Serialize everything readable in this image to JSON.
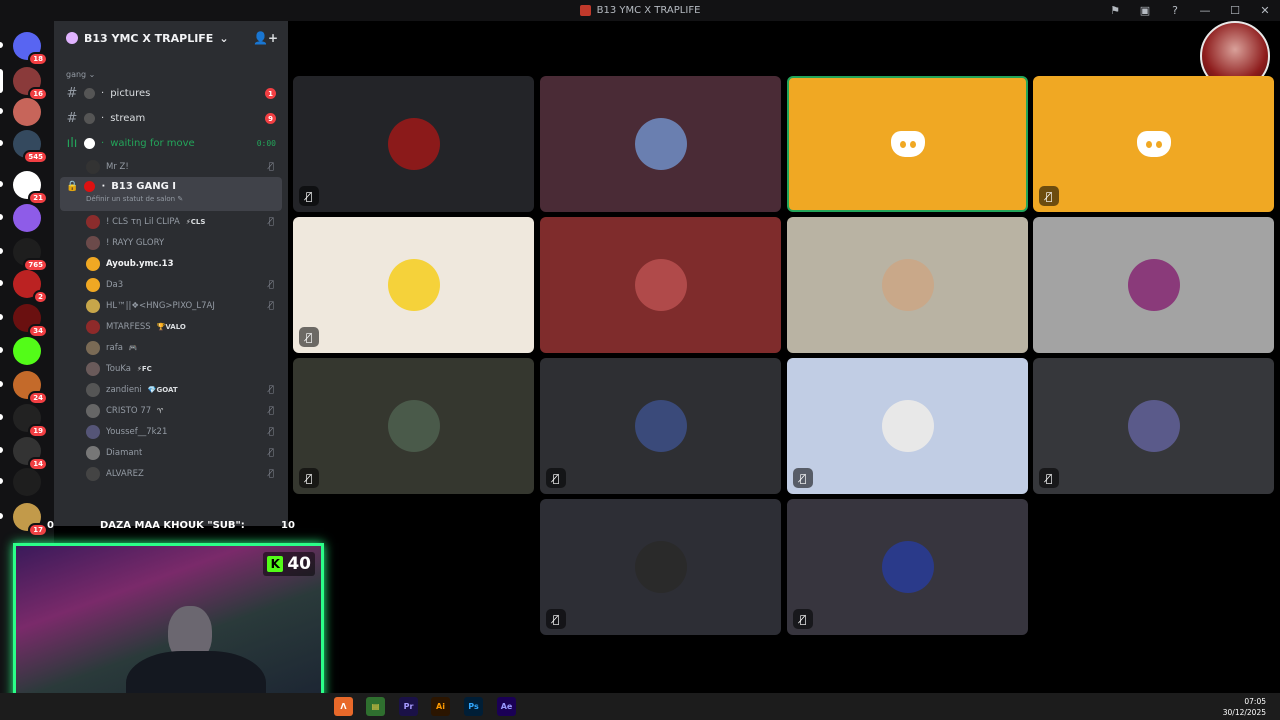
{
  "window": {
    "title": "B13 YMC X TRAPLIFE"
  },
  "servers": [
    {
      "badge": "18",
      "color": "#5865f2",
      "name": "discord-home"
    },
    {
      "badge": "16",
      "color": "#8a3a3a"
    },
    {
      "badge": "",
      "color": "#c7655a"
    },
    {
      "badge": "545",
      "color": "#34495e"
    },
    {
      "badge": "21",
      "color": "#ffffff"
    },
    {
      "badge": "",
      "color": "#8e5ce8"
    },
    {
      "badge": "765",
      "color": "#1e1e1e"
    },
    {
      "badge": "2",
      "color": "#b22"
    },
    {
      "badge": "34",
      "color": "#6a1010"
    },
    {
      "badge": "",
      "color": "#53fc18"
    },
    {
      "badge": "24",
      "color": "#c46a2a"
    },
    {
      "badge": "19",
      "color": "#222"
    },
    {
      "badge": "14",
      "color": "#333"
    },
    {
      "badge": "",
      "color": "#1e1e1e"
    },
    {
      "badge": "17",
      "color": "#c29a4a"
    }
  ],
  "sidebar": {
    "guild_name": "B13 YMC X TRAPLIFE",
    "category": "gang",
    "channels": [
      {
        "name": "pictures",
        "badge": "1"
      },
      {
        "name": "stream",
        "badge": "9"
      }
    ],
    "voice_waiting": {
      "name": "waiting for move",
      "timer": "0:00",
      "user": "Mr Z!"
    },
    "active_voice": {
      "name": "B13 GANG I",
      "status_hint": "Définir un statut de salon"
    },
    "voice_users": [
      {
        "name": "! CLS τη Lil CLIPA",
        "tag": "⚡CLS",
        "muted": true,
        "color": "#8b2c2c"
      },
      {
        "name": "! RAYY GLORY",
        "tag": "",
        "muted": false,
        "color": "#6b4a4a"
      },
      {
        "name": "Ayoub.ymc.13",
        "tag": "",
        "muted": false,
        "color": "#f0a823",
        "bright": true
      },
      {
        "name": "Da3",
        "tag": "",
        "muted": true,
        "color": "#f0a823"
      },
      {
        "name": "HL™||❖<HNG>PIXO_L7AJ",
        "tag": "",
        "muted": true,
        "color": "#c7a64a"
      },
      {
        "name": "MTARFESS",
        "tag": "🏆VALO",
        "muted": false,
        "color": "#8e2a2a"
      },
      {
        "name": "rafa",
        "tag": "🎮",
        "muted": false,
        "color": "#7a6a55"
      },
      {
        "name": "TouKa",
        "tag": "⚡FC",
        "muted": false,
        "color": "#6a5a5a"
      },
      {
        "name": "zandieni",
        "tag": "💎GOAT",
        "muted": true,
        "color": "#555"
      },
      {
        "name": "CRISTO 77",
        "tag": "♈",
        "muted": true,
        "color": "#666"
      },
      {
        "name": "Youssef__7k21",
        "tag": "",
        "muted": true,
        "color": "#557"
      },
      {
        "name": "Diamant",
        "tag": "",
        "muted": true,
        "color": "#777"
      },
      {
        "name": "ALVAREZ",
        "tag": "",
        "muted": true,
        "color": "#444"
      }
    ]
  },
  "overlay": {
    "left_value": "0",
    "label": "DAZA MAA KHOUK \"SUB\":",
    "right_value": "10"
  },
  "webcam": {
    "kick_count": "40"
  },
  "tiles": [
    {
      "bg": "#232428",
      "avatar": "#8b1a1a",
      "muted": true,
      "speaking": false,
      "type": "avatar"
    },
    {
      "bg": "#4a2b36",
      "avatar": "#6a7fb0",
      "muted": false,
      "speaking": false,
      "type": "avatar"
    },
    {
      "bg": "#f0a823",
      "avatar": "",
      "muted": false,
      "speaking": true,
      "type": "discord"
    },
    {
      "bg": "#f0a823",
      "avatar": "",
      "muted": true,
      "speaking": false,
      "type": "discord"
    },
    {
      "bg": "#efe8dd",
      "avatar": "#f5d23a",
      "muted": true,
      "speaking": false,
      "type": "avatar"
    },
    {
      "bg": "#7f2c2c",
      "avatar": "#b04a4a",
      "muted": false,
      "speaking": false,
      "type": "avatar"
    },
    {
      "bg": "#b9b3a3",
      "avatar": "#c9a889",
      "muted": false,
      "speaking": false,
      "type": "avatar"
    },
    {
      "bg": "#a3a3a3",
      "avatar": "#8a3a7a",
      "muted": false,
      "speaking": false,
      "type": "avatar"
    },
    {
      "bg": "#35372f",
      "avatar": "#4a5a4a",
      "muted": true,
      "speaking": false,
      "type": "avatar"
    },
    {
      "bg": "#2e2f33",
      "avatar": "#3a4a7a",
      "muted": true,
      "speaking": false,
      "type": "avatar"
    },
    {
      "bg": "#c1cde4",
      "avatar": "#e8e8e8",
      "muted": true,
      "speaking": false,
      "type": "avatar"
    },
    {
      "bg": "#36373b",
      "avatar": "#5a5a8a",
      "muted": true,
      "speaking": false,
      "type": "avatar"
    },
    {
      "bg": "#2d2e35",
      "avatar": "#2a2a2a",
      "muted": true,
      "speaking": false,
      "type": "avatar"
    },
    {
      "bg": "#37353e",
      "avatar": "#2a3a8a",
      "muted": true,
      "speaking": false,
      "type": "avatar"
    }
  ],
  "taskbar": {
    "time": "07:05",
    "date": "30/12/2025",
    "apps": [
      {
        "label": "Λ",
        "color": "#e8692a",
        "fg": "#fff"
      },
      {
        "label": "▤",
        "color": "#2f6f2f",
        "fg": "#ffd54a"
      },
      {
        "label": "Pr",
        "color": "#1a1147",
        "fg": "#a79bff"
      },
      {
        "label": "Ai",
        "color": "#2b1500",
        "fg": "#ff9a00"
      },
      {
        "label": "Ps",
        "color": "#001e36",
        "fg": "#31a8ff"
      },
      {
        "label": "Ae",
        "color": "#1a0055",
        "fg": "#9999ff"
      }
    ]
  }
}
